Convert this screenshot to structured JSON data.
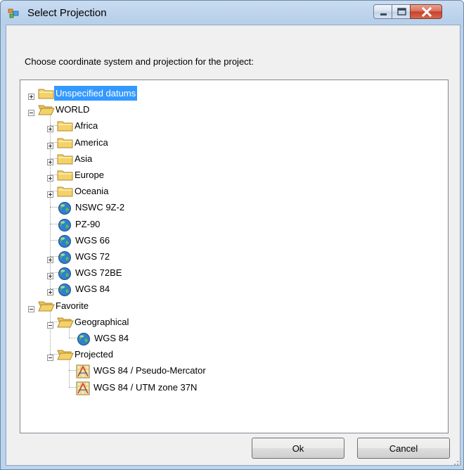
{
  "window": {
    "title": "Select Projection"
  },
  "prompt": "Choose coordinate system and projection for the project:",
  "tree": [
    {
      "id": "unspecified",
      "label": "Unspecified datums",
      "icon": "folder-closed-icon",
      "level": 0,
      "expander": "plus",
      "selected": true
    },
    {
      "id": "world",
      "label": "WORLD",
      "icon": "folder-open-icon",
      "level": 0,
      "expander": "minus"
    },
    {
      "id": "africa",
      "label": "Africa",
      "icon": "folder-closed-icon",
      "level": 1,
      "expander": "plus"
    },
    {
      "id": "america",
      "label": "America",
      "icon": "folder-closed-icon",
      "level": 1,
      "expander": "plus"
    },
    {
      "id": "asia",
      "label": "Asia",
      "icon": "folder-closed-icon",
      "level": 1,
      "expander": "plus"
    },
    {
      "id": "europe",
      "label": "Europe",
      "icon": "folder-closed-icon",
      "level": 1,
      "expander": "plus"
    },
    {
      "id": "oceania",
      "label": "Oceania",
      "icon": "folder-closed-icon",
      "level": 1,
      "expander": "plus"
    },
    {
      "id": "nswc",
      "label": "NSWC 9Z-2",
      "icon": "globe-icon",
      "level": 1,
      "expander": "none"
    },
    {
      "id": "pz90",
      "label": "PZ-90",
      "icon": "globe-icon",
      "level": 1,
      "expander": "none"
    },
    {
      "id": "wgs66",
      "label": "WGS 66",
      "icon": "globe-icon",
      "level": 1,
      "expander": "none"
    },
    {
      "id": "wgs72",
      "label": "WGS 72",
      "icon": "globe-icon",
      "level": 1,
      "expander": "plus"
    },
    {
      "id": "wgs72be",
      "label": "WGS 72BE",
      "icon": "globe-icon",
      "level": 1,
      "expander": "plus"
    },
    {
      "id": "wgs84",
      "label": "WGS 84",
      "icon": "globe-icon",
      "level": 1,
      "expander": "plus"
    },
    {
      "id": "favorite",
      "label": "Favorite",
      "icon": "folder-open-icon",
      "level": 0,
      "expander": "minus"
    },
    {
      "id": "geographical",
      "label": "Geographical",
      "icon": "folder-open-icon",
      "level": 1,
      "expander": "minus"
    },
    {
      "id": "fav-wgs84",
      "label": "WGS 84",
      "icon": "globe-icon",
      "level": 2,
      "expander": "none"
    },
    {
      "id": "projected",
      "label": "Projected",
      "icon": "folder-open-icon",
      "level": 1,
      "expander": "minus"
    },
    {
      "id": "pseudo-mercator",
      "label": "WGS 84 / Pseudo-Mercator",
      "icon": "projection-map-icon",
      "level": 2,
      "expander": "none"
    },
    {
      "id": "utm37n",
      "label": "WGS 84 / UTM zone 37N",
      "icon": "projection-map-icon",
      "level": 2,
      "expander": "none"
    }
  ],
  "buttons": {
    "ok": "Ok",
    "cancel": "Cancel"
  },
  "colors": {
    "selection": "#3399ff",
    "folder": "#f4d26a",
    "globe": "#2f7fd0"
  }
}
